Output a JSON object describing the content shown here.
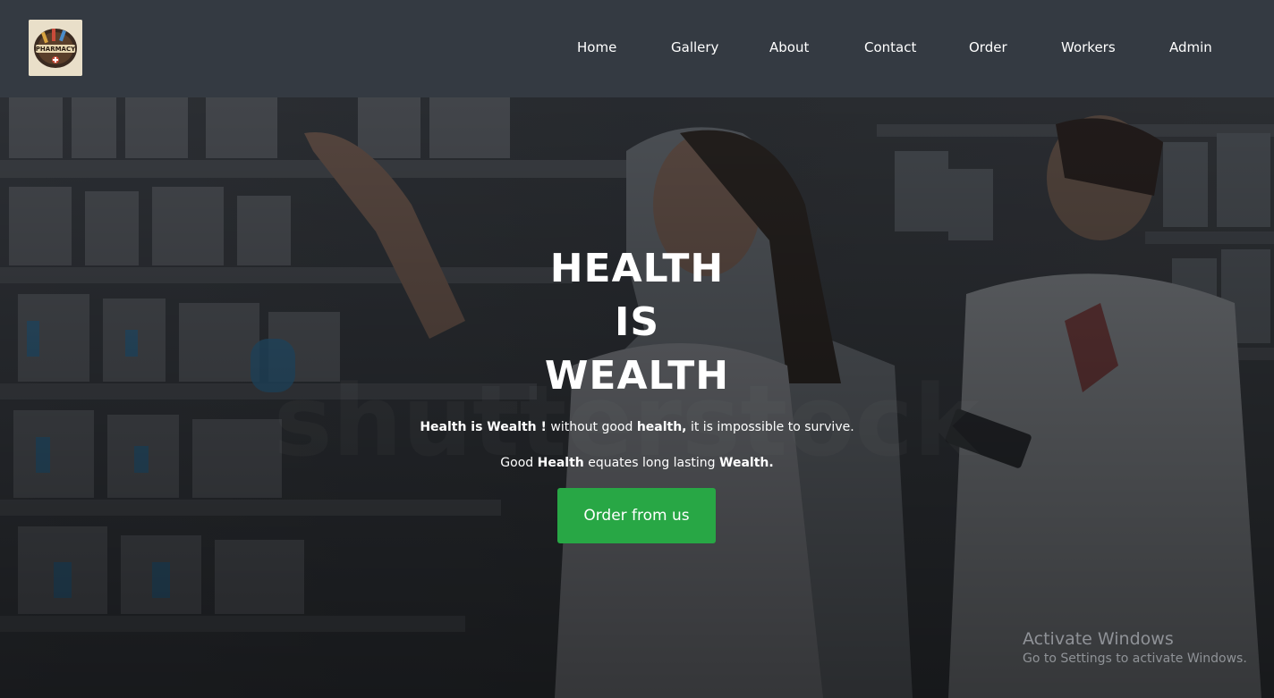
{
  "brand": {
    "logo_icon": "pharmacy-logo-icon",
    "logo_text": "PHARMACY"
  },
  "nav": {
    "items": [
      {
        "label": "Home"
      },
      {
        "label": "Gallery"
      },
      {
        "label": "About"
      },
      {
        "label": "Contact"
      },
      {
        "label": "Order"
      },
      {
        "label": "Workers"
      },
      {
        "label": "Admin"
      }
    ]
  },
  "hero": {
    "headline": [
      "HEALTH",
      "IS",
      "WEALTH"
    ],
    "tagline_1": {
      "bold_1": "Health is Wealth !",
      "text_1": " without good ",
      "bold_2": "health,",
      "text_2": " it is impossible to survive."
    },
    "tagline_2": {
      "text_1": "Good ",
      "bold_1": "Health",
      "text_2": " equates long lasting ",
      "bold_2": "Wealth."
    },
    "cta_label": "Order from us",
    "watermark": "shutterstock"
  },
  "os_overlay": {
    "title": "Activate Windows",
    "subtitle": "Go to Settings to activate Windows."
  },
  "colors": {
    "navbar": "#343a42",
    "cta": "#28a745",
    "text": "#ffffff"
  }
}
